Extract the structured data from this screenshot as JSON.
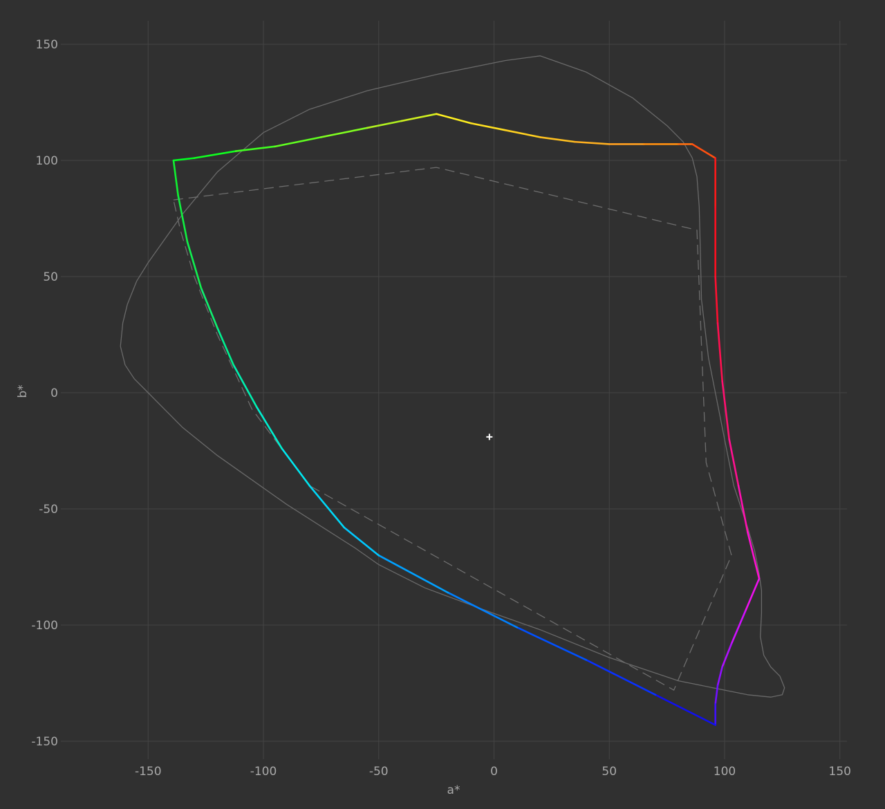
{
  "chart_data": {
    "type": "line",
    "xlabel": "a*",
    "ylabel": "b*",
    "xlim": [
      -190,
      153
    ],
    "ylim": [
      -158,
      160
    ],
    "x_ticks": [
      -150,
      -100,
      -50,
      0,
      50,
      100,
      150
    ],
    "y_ticks": [
      150,
      100,
      50,
      0,
      -50,
      -100,
      -150
    ],
    "grid": true,
    "legend": "none",
    "white_point": {
      "x": -2,
      "y": -19
    },
    "series": [
      {
        "style": "solid-thin",
        "color": "#6a6a6a",
        "points": [
          [
            -162,
            20
          ],
          [
            -161,
            30
          ],
          [
            -159,
            38
          ],
          [
            -155,
            48
          ],
          [
            -150,
            56
          ],
          [
            -135,
            77
          ],
          [
            -120,
            95
          ],
          [
            -100,
            112
          ],
          [
            -80,
            122
          ],
          [
            -55,
            130
          ],
          [
            -25,
            137
          ],
          [
            5,
            143
          ],
          [
            20,
            145
          ],
          [
            40,
            138
          ],
          [
            60,
            127
          ],
          [
            75,
            115
          ],
          [
            82,
            108
          ],
          [
            86,
            101
          ],
          [
            88,
            93
          ],
          [
            89,
            80
          ],
          [
            89.5,
            60
          ],
          [
            90,
            40
          ],
          [
            93,
            15
          ],
          [
            98,
            -10
          ],
          [
            104,
            -40
          ],
          [
            110,
            -58
          ],
          [
            113,
            -68
          ],
          [
            115,
            -78
          ],
          [
            116,
            -85
          ],
          [
            116,
            -95
          ],
          [
            115.5,
            -105
          ],
          [
            117,
            -113
          ],
          [
            120,
            -118
          ],
          [
            124,
            -122
          ],
          [
            126,
            -127
          ],
          [
            125,
            -130
          ],
          [
            120,
            -131
          ],
          [
            110,
            -130
          ],
          [
            95,
            -127
          ],
          [
            80,
            -124
          ],
          [
            50,
            -114
          ],
          [
            20,
            -102
          ],
          [
            0,
            -95
          ],
          [
            -30,
            -84
          ],
          [
            -50,
            -74
          ],
          [
            -60,
            -67
          ],
          [
            -90,
            -48
          ],
          [
            -120,
            -27
          ],
          [
            -135,
            -15
          ],
          [
            -145,
            -5
          ],
          [
            -150,
            0
          ],
          [
            -156,
            6
          ],
          [
            -160,
            12
          ],
          [
            -162,
            20
          ]
        ]
      },
      {
        "style": "dashed",
        "color": "#6e6e6e",
        "points": [
          [
            -139,
            83
          ],
          [
            -25,
            97
          ],
          [
            88,
            70
          ],
          [
            92,
            -30
          ],
          [
            103,
            -70
          ],
          [
            78,
            -128
          ],
          [
            -80,
            -40
          ],
          [
            -105,
            -7
          ],
          [
            -120,
            25
          ],
          [
            -130,
            50
          ],
          [
            -136,
            70
          ],
          [
            -139,
            83
          ]
        ]
      },
      {
        "style": "gamut",
        "points": [
          [
            -139,
            100,
            "#00ff20"
          ],
          [
            -130,
            101,
            "#10ff20"
          ],
          [
            -112,
            104,
            "#40ff20"
          ],
          [
            -95,
            106,
            "#60ff20"
          ],
          [
            -75,
            110,
            "#80ff20"
          ],
          [
            -55,
            114,
            "#b0f020"
          ],
          [
            -40,
            117,
            "#d0f020"
          ],
          [
            -25,
            120,
            "#fff020"
          ],
          [
            -10,
            116,
            "#ffe020"
          ],
          [
            5,
            113,
            "#ffd020"
          ],
          [
            20,
            110,
            "#ffc020"
          ],
          [
            35,
            108,
            "#ffb020"
          ],
          [
            50,
            107,
            "#ffa020"
          ],
          [
            65,
            107,
            "#ff9010"
          ],
          [
            80,
            107,
            "#ff7010"
          ],
          [
            86,
            107,
            "#ff5010"
          ],
          [
            96,
            101,
            "#ff1a1a"
          ],
          [
            96,
            80,
            "#ff1020"
          ],
          [
            96,
            50,
            "#ff1030"
          ],
          [
            97,
            30,
            "#ff1050"
          ],
          [
            99,
            5,
            "#ff1070"
          ],
          [
            102,
            -20,
            "#ff1090"
          ],
          [
            106,
            -40,
            "#ff10b0"
          ],
          [
            110,
            -60,
            "#ff10d0"
          ],
          [
            115,
            -80,
            "#ee10ee"
          ],
          [
            109,
            -94,
            "#d010ff"
          ],
          [
            103,
            -108,
            "#b010ff"
          ],
          [
            99,
            -118,
            "#9010ff"
          ],
          [
            97,
            -126,
            "#7010ff"
          ],
          [
            96,
            -134,
            "#4010ff"
          ],
          [
            96,
            -143,
            "#1010ee"
          ],
          [
            70,
            -130,
            "#0830ff"
          ],
          [
            40,
            -115,
            "#0050ff"
          ],
          [
            10,
            -101,
            "#0080ff"
          ],
          [
            -20,
            -86,
            "#00a0ff"
          ],
          [
            -50,
            -70,
            "#00c8ff"
          ],
          [
            -65,
            -58,
            "#00d8f8"
          ],
          [
            -80,
            -40,
            "#00e8f0"
          ],
          [
            -92,
            -24,
            "#00f0d0"
          ],
          [
            -103,
            -6,
            "#00f0b0"
          ],
          [
            -113,
            12,
            "#00f090"
          ],
          [
            -120,
            28,
            "#10f070"
          ],
          [
            -127,
            45,
            "#10f050"
          ],
          [
            -133,
            65,
            "#10f040"
          ],
          [
            -137,
            85,
            "#10f030"
          ],
          [
            -139,
            100,
            "#00ff20"
          ]
        ]
      }
    ]
  }
}
